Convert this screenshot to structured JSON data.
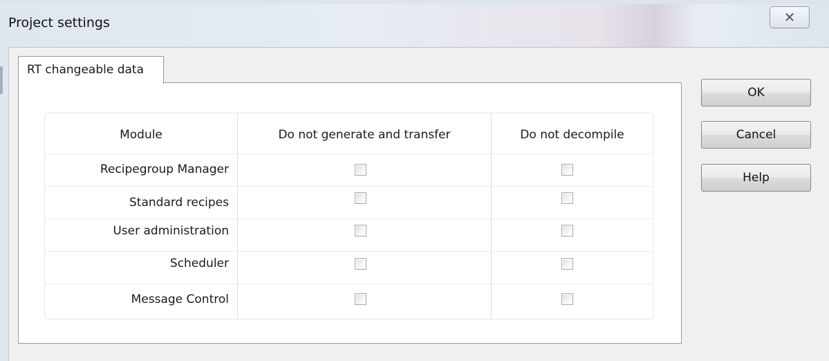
{
  "window": {
    "title": "Project settings",
    "close_glyph": "✕",
    "close_icon": "close-icon"
  },
  "tabs": [
    {
      "label": "RT changeable data",
      "selected": true
    }
  ],
  "table": {
    "headers": [
      "Module",
      "Do not generate and transfer",
      "Do not decompile"
    ],
    "rows": [
      {
        "module": "Recipegroup Manager",
        "do_not_generate_and_transfer": false,
        "do_not_decompile": false
      },
      {
        "module": "Standard recipes",
        "do_not_generate_and_transfer": false,
        "do_not_decompile": false
      },
      {
        "module": "User administration",
        "do_not_generate_and_transfer": false,
        "do_not_decompile": false
      },
      {
        "module": "Scheduler",
        "do_not_generate_and_transfer": false,
        "do_not_decompile": false
      },
      {
        "module": "Message Control",
        "do_not_generate_and_transfer": false,
        "do_not_decompile": false
      }
    ]
  },
  "buttons": {
    "ok": "OK",
    "cancel": "Cancel",
    "help": "Help"
  }
}
